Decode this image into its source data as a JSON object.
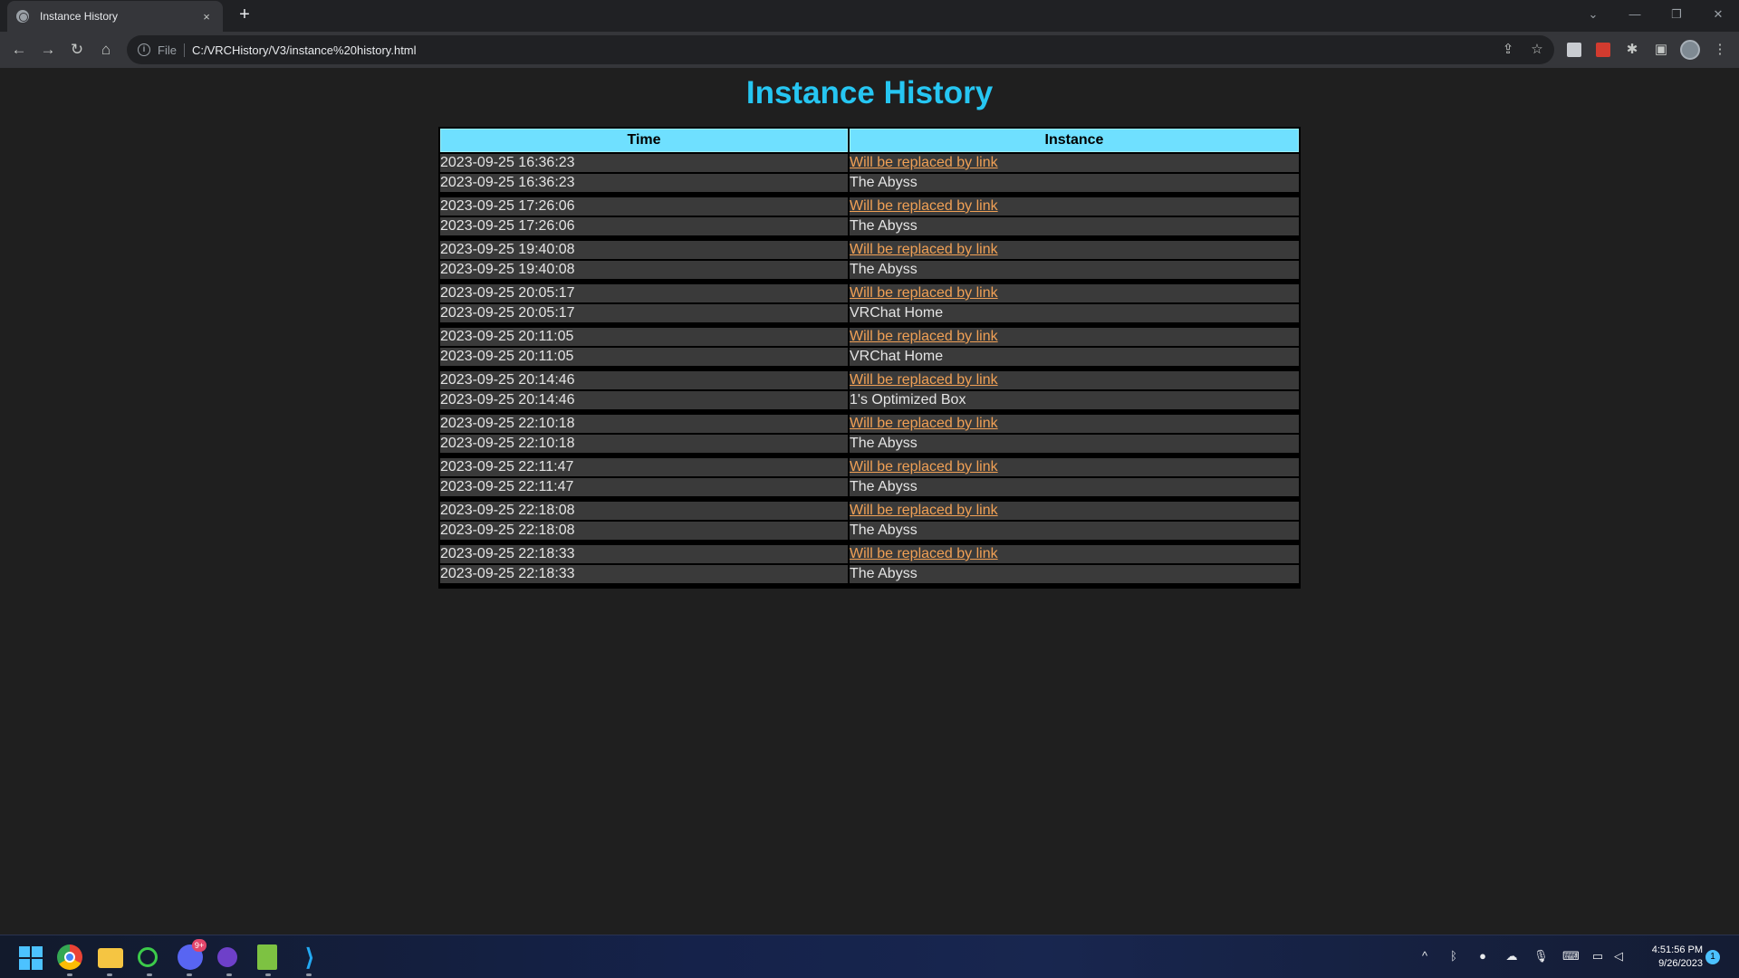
{
  "browser": {
    "tab_title": "Instance History",
    "tab_close": "×",
    "new_tab": "+",
    "url_scheme": "File",
    "url": "C:/VRCHistory/V3/instance%20history.html"
  },
  "page": {
    "title": "Instance History",
    "columns": [
      "Time",
      "Instance"
    ],
    "link_color": "#f0a055",
    "header_color": "#6fe0ff",
    "title_color": "#26c6f2",
    "rows": [
      {
        "time": "2023-09-25 16:36:23",
        "link": "Will be replaced by link",
        "name": "The Abyss"
      },
      {
        "time": "2023-09-25 17:26:06",
        "link": "Will be replaced by link",
        "name": "The Abyss"
      },
      {
        "time": "2023-09-25 19:40:08",
        "link": "Will be replaced by link",
        "name": "The Abyss"
      },
      {
        "time": "2023-09-25 20:05:17",
        "link": "Will be replaced by link",
        "name": "VRChat Home"
      },
      {
        "time": "2023-09-25 20:11:05",
        "link": "Will be replaced by link",
        "name": "VRChat Home"
      },
      {
        "time": "2023-09-25 20:14:46",
        "link": "Will be replaced by link",
        "name": "1's Optimized Box"
      },
      {
        "time": "2023-09-25 22:10:18",
        "link": "Will be replaced by link",
        "name": "The Abyss"
      },
      {
        "time": "2023-09-25 22:11:47",
        "link": "Will be replaced by link",
        "name": "The Abyss"
      },
      {
        "time": "2023-09-25 22:18:08",
        "link": "Will be replaced by link",
        "name": "The Abyss"
      },
      {
        "time": "2023-09-25 22:18:33",
        "link": "Will be replaced by link",
        "name": "The Abyss"
      }
    ]
  },
  "taskbar": {
    "time": "4:51:56 PM",
    "date": "9/26/2023",
    "notification_count": "1",
    "discord_badge": "9+"
  }
}
